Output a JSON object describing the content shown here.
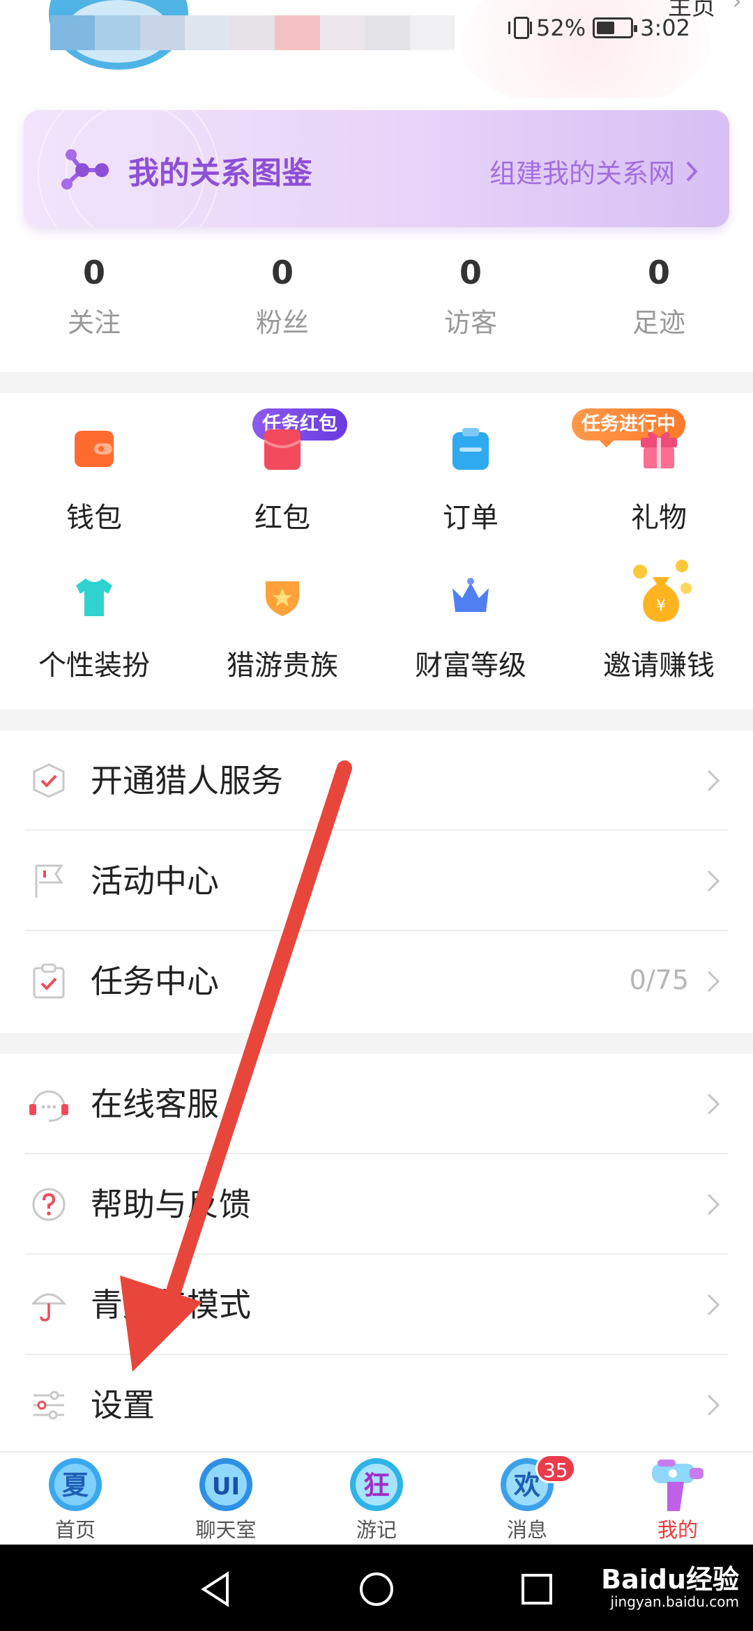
{
  "status_bar": {
    "battery": "52%",
    "time": "3:02",
    "battery_level": 0.52
  },
  "profile": {
    "home_link": "主页"
  },
  "relation_banner": {
    "title": "我的关系图鉴",
    "link": "组建我的关系网"
  },
  "stats": [
    {
      "value": "0",
      "label": "关注"
    },
    {
      "value": "0",
      "label": "粉丝"
    },
    {
      "value": "0",
      "label": "访客"
    },
    {
      "value": "0",
      "label": "足迹"
    }
  ],
  "features": {
    "row1": [
      {
        "label": "钱包",
        "icon": "wallet-icon",
        "color": "#ff6a2f"
      },
      {
        "label": "红包",
        "icon": "red-envelope-icon",
        "color": "#f2495c",
        "badge": "任务红包"
      },
      {
        "label": "订单",
        "icon": "order-icon",
        "color": "#2fa9f0"
      },
      {
        "label": "礼物",
        "icon": "gift-icon",
        "color": "#f04b78",
        "badge": "任务进行中"
      }
    ],
    "row2": [
      {
        "label": "个性装扮",
        "icon": "tshirt-icon",
        "color": "#2fd3d0"
      },
      {
        "label": "猎游贵族",
        "icon": "noble-shield-icon",
        "color": "#ffa23a"
      },
      {
        "label": "财富等级",
        "icon": "crown-icon",
        "color": "#4f7ff0"
      },
      {
        "label": "邀请赚钱",
        "icon": "money-bag-icon",
        "color": "#ffb31f"
      }
    ]
  },
  "menu_group1": [
    {
      "label": "开通猎人服务",
      "icon": "shield-check-icon",
      "value": ""
    },
    {
      "label": "活动中心",
      "icon": "flag-icon",
      "value": ""
    },
    {
      "label": "任务中心",
      "icon": "clipboard-check-icon",
      "value": "0/75"
    }
  ],
  "menu_group2": [
    {
      "label": "在线客服",
      "icon": "headset-icon"
    },
    {
      "label": "帮助与反馈",
      "icon": "help-icon"
    },
    {
      "label": "青少年模式",
      "icon": "umbrella-icon"
    },
    {
      "label": "设置",
      "icon": "settings-sliders-icon"
    }
  ],
  "tabs": [
    {
      "label": "首页",
      "glyph": "夏"
    },
    {
      "label": "聊天室",
      "glyph": "UI"
    },
    {
      "label": "游记",
      "glyph": "狂"
    },
    {
      "label": "消息",
      "glyph": "欢",
      "badge": "35"
    },
    {
      "label": "我的",
      "active": true
    }
  ],
  "watermark": {
    "brand": "Baidu经验",
    "url": "jingyan.baidu.com"
  },
  "colors": {
    "accent_purple": "#8c4fd6",
    "active_tab": "#e63b3b",
    "annotation_arrow": "#e8463b"
  }
}
